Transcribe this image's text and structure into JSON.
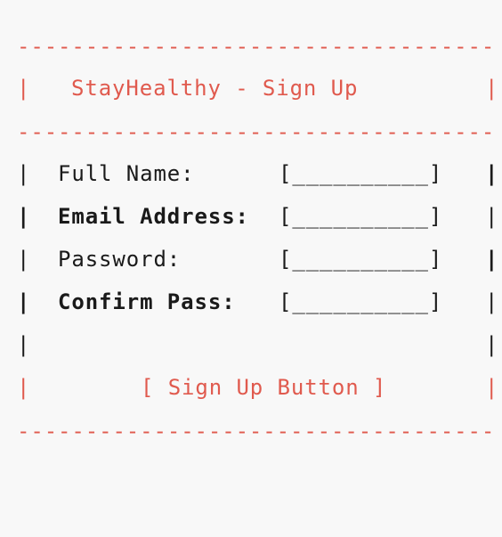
{
  "border": {
    "dash_line": "------------------------------------",
    "pipe": "|"
  },
  "header": {
    "title": "StayHealthy - Sign Up"
  },
  "form": {
    "fields": [
      {
        "label": "Full Name:",
        "value": "[__________]"
      },
      {
        "label": "Email Address:",
        "value": "[__________]"
      },
      {
        "label": "Password:",
        "value": "[__________]"
      },
      {
        "label": "Confirm Pass:",
        "value": "[__________]"
      }
    ],
    "submit_label": "[ Sign Up Button ]"
  },
  "colors": {
    "accent": "#e05a4e",
    "text": "#1a1a1a",
    "background": "#f8f8f8"
  }
}
